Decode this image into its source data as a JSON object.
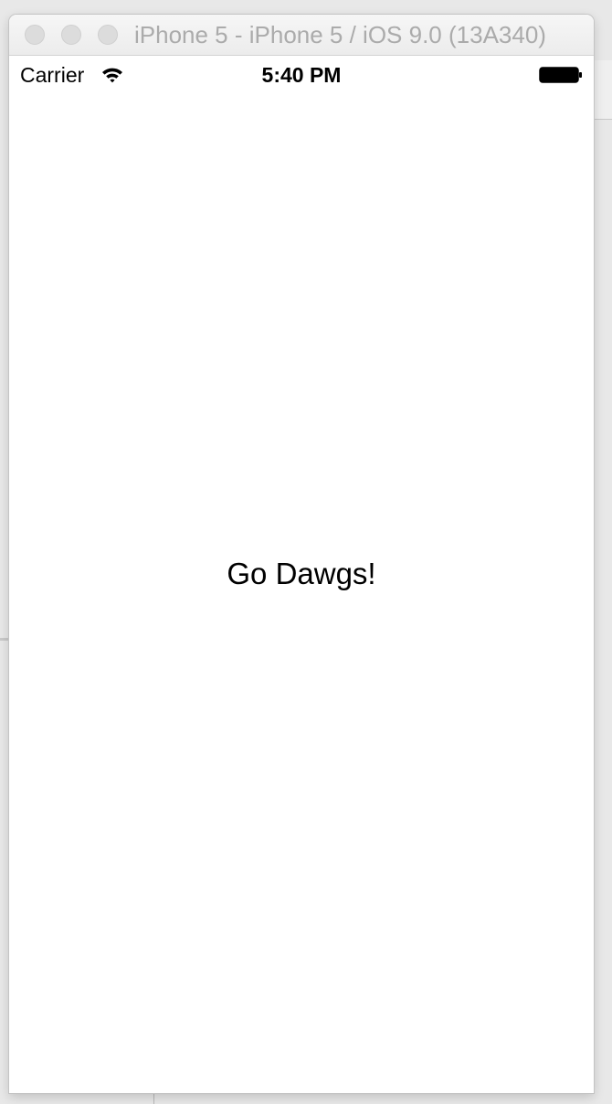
{
  "window": {
    "title": "iPhone 5 - iPhone 5 / iOS 9.0 (13A340)"
  },
  "status_bar": {
    "carrier": "Carrier",
    "time": "5:40 PM",
    "wifi_icon": "wifi-icon",
    "battery_icon": "battery-icon"
  },
  "main": {
    "label": "Go Dawgs!"
  },
  "colors": {
    "title_text": "#ababab",
    "screen_background": "#ffffff",
    "text": "#000000"
  }
}
